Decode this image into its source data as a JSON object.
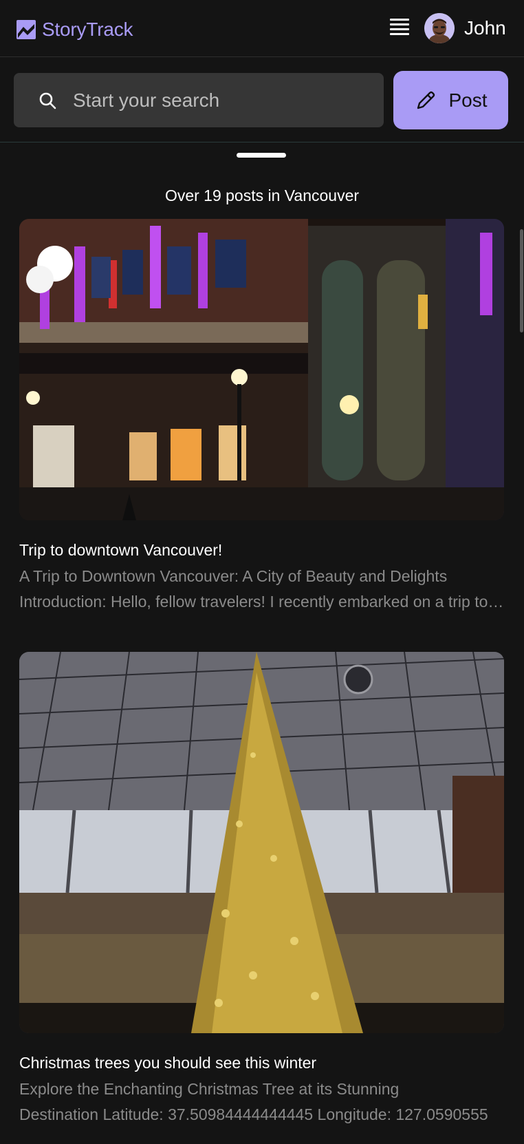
{
  "app": {
    "name": "StoryTrack",
    "brand_color": "#a99bf5"
  },
  "header": {
    "logo_icon": "storytrack-logo-icon",
    "menu_icon": "hamburger-menu-icon",
    "user": {
      "name": "John",
      "avatar": "user-avatar-memoji"
    }
  },
  "search": {
    "placeholder": "Start your search",
    "value": "",
    "icon": "search-icon"
  },
  "post_button": {
    "label": "Post",
    "icon": "pencil-icon"
  },
  "results": {
    "summary": "Over 19 posts in Vancouver"
  },
  "posts": [
    {
      "title": "Trip to downtown Vancouver!",
      "excerpt_line1": "A Trip to Downtown Vancouver: A City of Beauty and Delights",
      "excerpt_line2": "Introduction: Hello, fellow travelers! I recently embarked on a trip to downtown Vancouver",
      "image": "gastown-steam-clock-night-photo"
    },
    {
      "title": "Christmas trees you should see this winter",
      "excerpt_line1": "Explore the Enchanting Christmas Tree at its Stunning",
      "excerpt_line2": "Destination Latitude: 37.50984444444445 Longitude: 127.0590555",
      "image": "golden-christmas-tree-atrium-photo"
    }
  ]
}
